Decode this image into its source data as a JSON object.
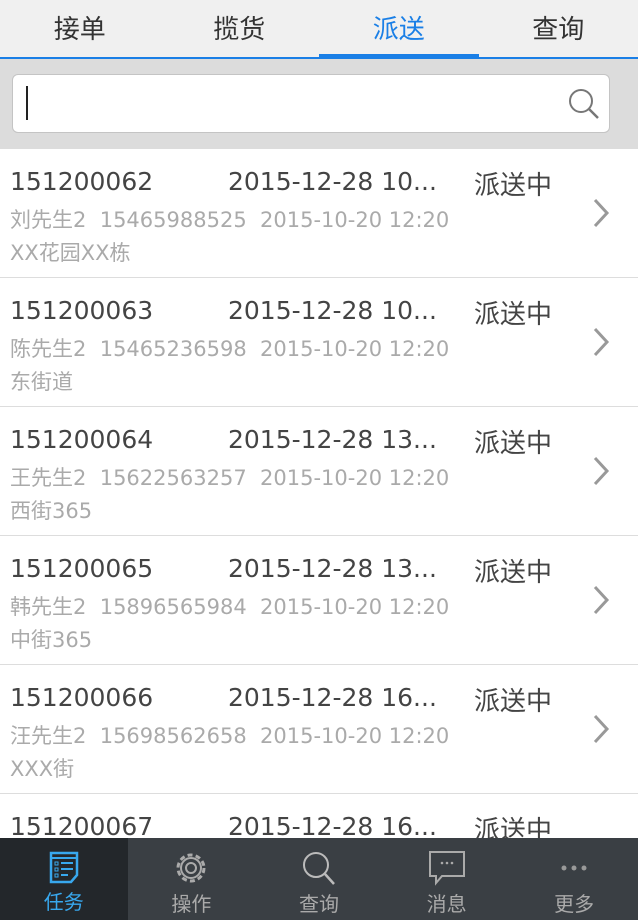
{
  "tabs": [
    {
      "label": "接单"
    },
    {
      "label": "揽货"
    },
    {
      "label": "派送"
    },
    {
      "label": "查询"
    }
  ],
  "active_tab": 2,
  "search": {
    "value": "",
    "placeholder": ""
  },
  "orders": [
    {
      "id": "151200062",
      "time": "2015-12-28 10...",
      "status": "派送中",
      "contact": "刘先生2  15465988525  2015-10-20 12:20",
      "address": "XX花园XX栋"
    },
    {
      "id": "151200063",
      "time": "2015-12-28 10...",
      "status": "派送中",
      "contact": "陈先生2  15465236598  2015-10-20 12:20",
      "address": "东街道"
    },
    {
      "id": "151200064",
      "time": "2015-12-28 13...",
      "status": "派送中",
      "contact": "王先生2  15622563257  2015-10-20 12:20",
      "address": "西街365"
    },
    {
      "id": "151200065",
      "time": "2015-12-28 13...",
      "status": "派送中",
      "contact": "韩先生2  15896565984  2015-10-20 12:20",
      "address": "中街365"
    },
    {
      "id": "151200066",
      "time": "2015-12-28 16...",
      "status": "派送中",
      "contact": "汪先生2  15698562658  2015-10-20 12:20",
      "address": "XXX街"
    },
    {
      "id": "151200067",
      "time": "2015-12-28 16...",
      "status": "派送中",
      "contact": "",
      "address": ""
    }
  ],
  "nav": [
    {
      "label": "任务",
      "icon": "task-list-icon"
    },
    {
      "label": "操作",
      "icon": "gear-icon"
    },
    {
      "label": "查询",
      "icon": "search-icon"
    },
    {
      "label": "消息",
      "icon": "message-icon"
    },
    {
      "label": "更多",
      "icon": "more-icon"
    }
  ],
  "colors": {
    "accent": "#1a7fe6",
    "nav_bg": "#3a3f44"
  }
}
